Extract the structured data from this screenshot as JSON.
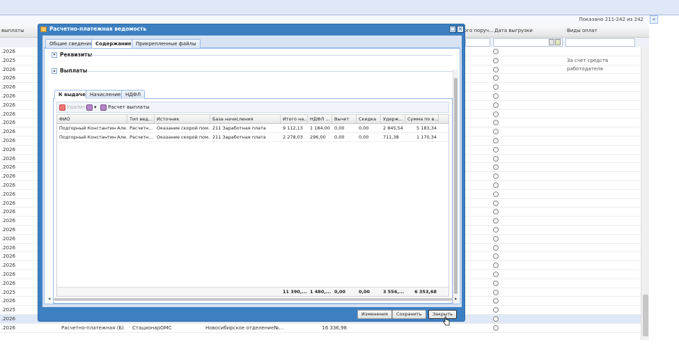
{
  "background": {
    "pager_text": "Показано 211-242 из 242",
    "columns": [
      "выплаты",
      "Дата выгрузки",
      "Виды оплат",
      "ого поруч..."
    ],
    "rows": [
      {
        "date": ".2026",
        "payment_type": ""
      },
      {
        "date": ".2025",
        "payment_type": "За счет средств работодателя"
      },
      {
        "date": ".2026",
        "payment_type": ""
      },
      {
        "date": ".2026",
        "payment_type": ""
      },
      {
        "date": ".2026",
        "payment_type": ""
      },
      {
        "date": ".2026",
        "payment_type": ""
      },
      {
        "date": ".2026",
        "payment_type": ""
      },
      {
        "date": ".2026",
        "payment_type": ""
      },
      {
        "date": ".2026",
        "payment_type": ""
      },
      {
        "date": ".2026",
        "payment_type": ""
      },
      {
        "date": ".2026",
        "payment_type": ""
      },
      {
        "date": ".2026",
        "payment_type": ""
      },
      {
        "date": ".2026",
        "payment_type": ""
      },
      {
        "date": ".2026",
        "payment_type": ""
      },
      {
        "date": ".2026",
        "payment_type": ""
      },
      {
        "date": ".2026",
        "payment_type": ""
      },
      {
        "date": ".2026",
        "payment_type": ""
      },
      {
        "date": ".2026",
        "payment_type": ""
      },
      {
        "date": ".2026",
        "payment_type": ""
      },
      {
        "date": ".2026",
        "payment_type": ""
      },
      {
        "date": ".2026",
        "payment_type": ""
      },
      {
        "date": ".2026",
        "payment_type": ""
      },
      {
        "date": ".2026",
        "payment_type": ""
      },
      {
        "date": ".2026",
        "payment_type": ""
      },
      {
        "date": ".2026",
        "payment_type": ""
      },
      {
        "date": ".2026",
        "payment_type": ""
      },
      {
        "date": ".2026",
        "payment_type": ""
      },
      {
        "date": ".2025",
        "payment_type": ""
      },
      {
        "date": ".2026",
        "payment_type": ""
      },
      {
        "date": ".2025",
        "payment_type": ""
      },
      {
        "date": ".2026",
        "payment_type": ""
      },
      {
        "date": ".2026",
        "payment_type": ""
      }
    ],
    "last_row": {
      "doc": "Расчетно-платежная (Б)",
      "source": "СтационарОМС",
      "dept": "Новосибирское отделение№...",
      "sum": "16 336,98"
    }
  },
  "window": {
    "title": "Расчетно-платежная ведомость",
    "tabs": [
      "Общие сведения",
      "Содержание",
      "Прикрепленные файлы"
    ],
    "active_tab": "Содержание",
    "sections": {
      "requisites": "Реквизиты",
      "payments": "Выплаты"
    },
    "inner_tabs": [
      "К выдаче",
      "Начисление",
      "НДФЛ"
    ],
    "toolbar": {
      "delete": "Удалить",
      "calc": "Расчет выплаты"
    },
    "grid": {
      "headers": [
        "ФИО",
        "Тип вед...",
        "Источник",
        "База начисления",
        "Итого на...",
        "НДФЛ ...",
        "Вычет",
        "Скидка",
        "Удерж...",
        "Сумма по в..."
      ],
      "rows": [
        [
          "Подгорный Константин Але...",
          "Расчетн...",
          "Оказание скорой пом...",
          "211 Заработная плата",
          "9 112,13",
          "1 184,00",
          "0,00",
          "0,00",
          "2 845,54",
          "5 183,34"
        ],
        [
          "Подгорный Константин Але...",
          "Расчетн...",
          "Оказание скорой пом...",
          "211 Заработная плата",
          "2 278,03",
          "296,00",
          "0,00",
          "0,00",
          "711,38",
          "1 170,34"
        ]
      ],
      "totals": [
        "11 390,...",
        "1 480,...",
        "0,00",
        "0,00",
        "3 556,...",
        "6 353,68"
      ]
    },
    "buttons": {
      "changes": "Изменения",
      "save": "Сохранить",
      "close": "Закрыть"
    }
  }
}
